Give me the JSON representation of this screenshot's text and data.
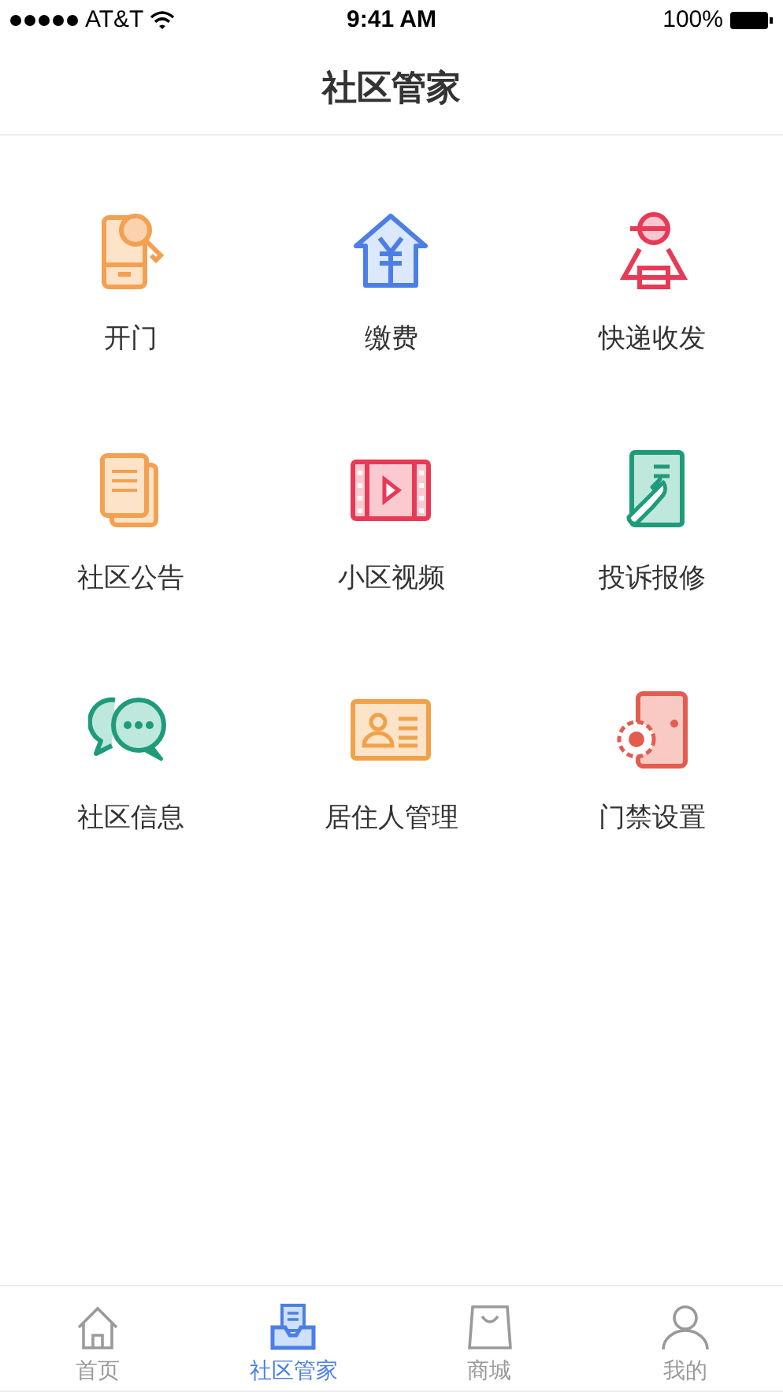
{
  "status_bar": {
    "carrier": "AT&T",
    "time": "9:41 AM",
    "battery": "100%"
  },
  "header": {
    "title": "社区管家"
  },
  "tiles": [
    {
      "kind": "phone-key",
      "label": "开门"
    },
    {
      "kind": "house-yen",
      "label": "缴费"
    },
    {
      "kind": "courier",
      "label": "快递收发"
    },
    {
      "kind": "documents",
      "label": "社区公告"
    },
    {
      "kind": "film",
      "label": "小区视频"
    },
    {
      "kind": "wrench-doc",
      "label": "投诉报修"
    },
    {
      "kind": "chat",
      "label": "社区信息"
    },
    {
      "kind": "id-card",
      "label": "居住人管理"
    },
    {
      "kind": "door-gear",
      "label": "门禁设置"
    }
  ],
  "tab_bar": [
    {
      "kind": "home",
      "label": "首页",
      "selected": false
    },
    {
      "kind": "inbox",
      "label": "社区管家",
      "selected": true
    },
    {
      "kind": "bag",
      "label": "商城",
      "selected": false
    },
    {
      "kind": "person",
      "label": "我的",
      "selected": false
    }
  ]
}
